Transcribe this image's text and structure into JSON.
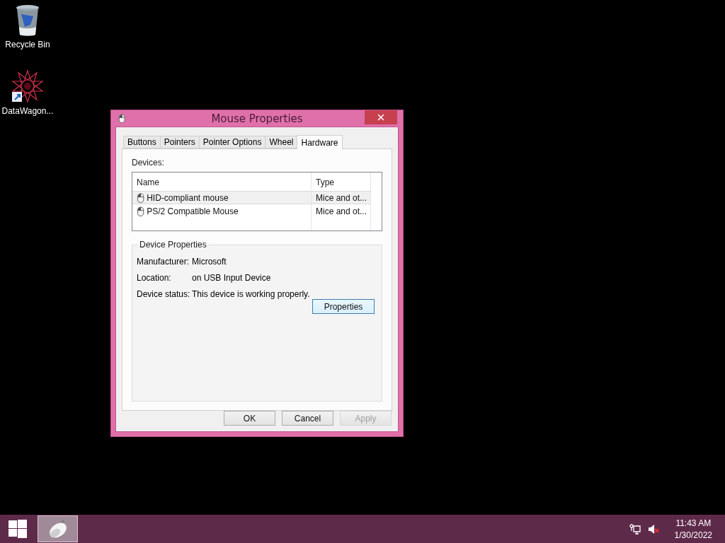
{
  "desktop_icons": [
    {
      "label": "Recycle Bin",
      "kind": "recycle"
    },
    {
      "label": "DataWagon...",
      "kind": "shortcut"
    }
  ],
  "dialog": {
    "title": "Mouse Properties",
    "tabs": [
      {
        "label": "Buttons",
        "selected": false
      },
      {
        "label": "Pointers",
        "selected": false
      },
      {
        "label": "Pointer Options",
        "selected": false
      },
      {
        "label": "Wheel",
        "selected": false
      },
      {
        "label": "Hardware",
        "selected": true
      }
    ],
    "devices_label": "Devices:",
    "columns": [
      "Name",
      "Type"
    ],
    "rows": [
      {
        "name": "HID-compliant mouse",
        "type": "Mice and ot...",
        "selected": true
      },
      {
        "name": "PS/2 Compatible Mouse",
        "type": "Mice and ot...",
        "selected": false
      }
    ],
    "group_title": "Device Properties",
    "properties": [
      {
        "label": "Manufacturer:",
        "value": "Microsoft"
      },
      {
        "label": "Location:",
        "value": "on USB Input Device"
      },
      {
        "label": "Device status:",
        "value": "This device is working properly."
      }
    ],
    "properties_button": "Properties",
    "buttons": [
      {
        "label": "OK",
        "disabled": false
      },
      {
        "label": "Cancel",
        "disabled": false
      },
      {
        "label": "Apply",
        "disabled": true
      }
    ]
  },
  "taskbar": {
    "time": "11:43 AM",
    "date": "1/30/2022"
  }
}
